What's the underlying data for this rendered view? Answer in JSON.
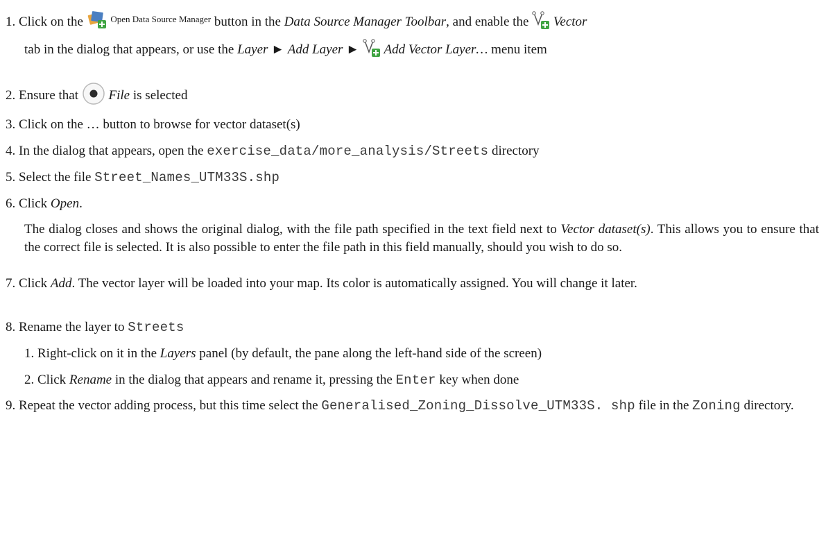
{
  "steps": [
    {
      "num": "1.",
      "t1": "Click on the",
      "icon1_label": "Open Data Source Manager",
      "t2": "button in the",
      "t3": "Data Source Manager Toolbar",
      "t4": ", and enable the",
      "t5": "Vector",
      "t6": "tab in the dialog that appears, or use the",
      "t7": "Layer",
      "arrow": "►",
      "t8": "Add Layer",
      "t9": "Add Vector Layer…",
      "t10": "menu item"
    },
    {
      "num": "2.",
      "t1": "Ensure that",
      "t2": "File",
      "t3": "is selected"
    },
    {
      "num": "3.",
      "t1": "Click on the … button to browse for vector dataset(s)"
    },
    {
      "num": "4.",
      "t1": "In the dialog that appears, open the",
      "code": "exercise_data/more_analysis/Streets",
      "t2": "directory"
    },
    {
      "num": "5.",
      "t1": "Select the file",
      "code": "Street_Names_UTM33S.shp"
    },
    {
      "num": "6.",
      "t1": "Click",
      "t2": "Open",
      "t3": "."
    },
    {
      "num": "7.",
      "t1": "Click",
      "t2": "Add",
      "t3": ". The vector layer will be loaded into your map. Its color is automatically assigned. You will change it later."
    },
    {
      "num": "8.",
      "t1": "Rename the layer to",
      "code": "Streets"
    },
    {
      "num": "9.",
      "t1": "Repeat the vector adding process, but this time select the",
      "code1": "Generalised_Zoning_Dissolve_UTM33S. shp",
      "t2": "file in the",
      "code2": "Zoning",
      "t3": "directory."
    }
  ],
  "paragraph": {
    "t1": "The dialog closes and shows the original dialog, with the file path specified in the text field next to",
    "t2": "Vector dataset(s)",
    "t3": ". This allows you to ensure that the correct file is selected. It is also possible to enter the file path in this field manually, should you wish to do so."
  },
  "substeps": [
    {
      "num": "1.",
      "t1": "Right-click on it in the",
      "t2": "Layers",
      "t3": "panel (by default, the pane along the left-hand side of the screen)"
    },
    {
      "num": "2.",
      "t1": "Click",
      "t2": "Rename",
      "t3": "in the dialog that appears and rename it, pressing the",
      "code": "Enter",
      "t4": "key when done"
    }
  ]
}
